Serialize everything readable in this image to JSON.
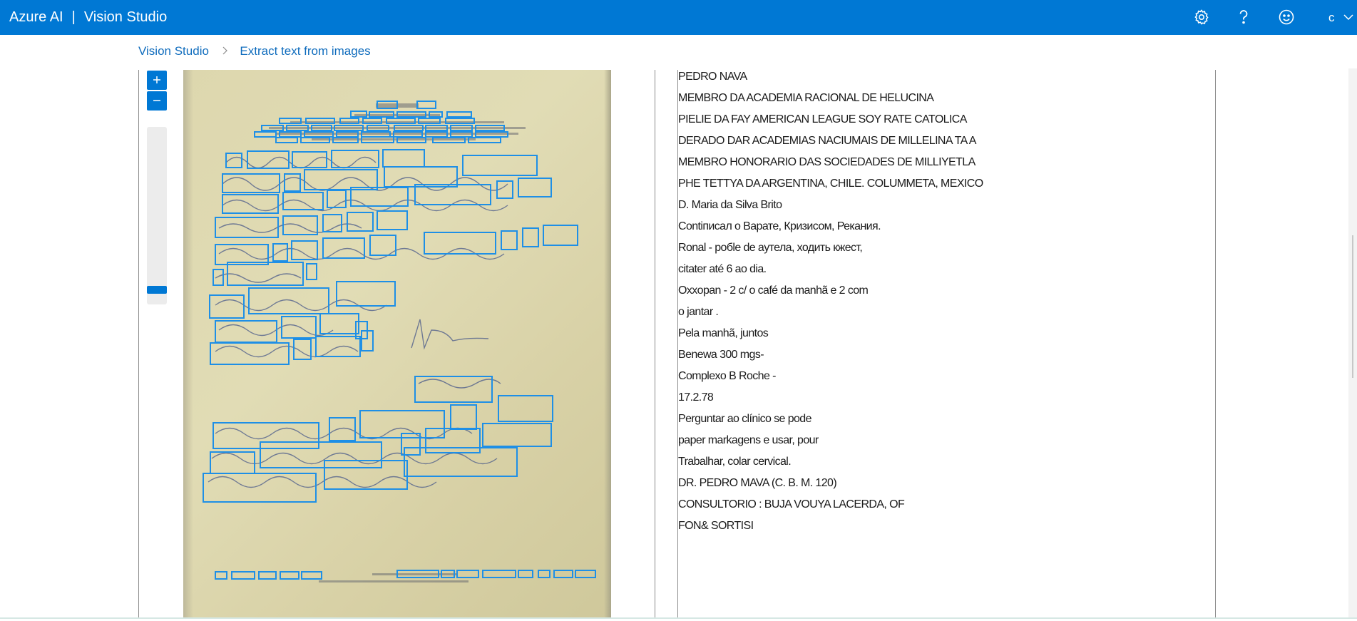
{
  "header": {
    "brand": "Azure AI",
    "separator": "|",
    "product": "Vision Studio",
    "user_initial": "c",
    "icons": [
      "gear-icon",
      "help-icon",
      "smile-icon",
      "chevron-down-icon"
    ]
  },
  "breadcrumb": {
    "items": [
      "Vision Studio",
      "Extract text from images"
    ]
  },
  "viewer": {
    "zoom_in_icon": "plus-icon",
    "zoom_out_icon": "minus-icon",
    "zoom_level": 0.1
  },
  "extracted_text": {
    "lines": [
      "PEDRO NAVA",
      "MEMBRO DA ACADEMIA RACIONAL DE HELUCINA",
      "PIELIE DA FAY AMERICAN LEAGUE SOY RATE CATOLICA",
      "DERADO DAR ACADEMIAS NACIUMAIS DE MILLELINA TA A",
      "MEMBRO HONORARIO DAS SOCIEDADES DE MILLIYETLA",
      "PHE TETTYA DA ARGENTINA, CHILE. COLUMMETA, MEXICO",
      "D. Maria da Silva Brito",
      "Contіписал о Варате, Кризисом, Рекания.",
      "Ronal - робle de aутела, ходить кжест,",
      "citater até 6 ao dia.",
      "Oxxopan - 2 c/ o café da manhã e 2 com",
      "o jantar .",
      "Pela manhã, juntos",
      "Benewa 300 mgs-",
      "Complexo B Roche -",
      "17.2.78",
      "Perguntar ao clínico se pode",
      "paper markagens e usar, pour",
      "Trabalhar, colar cervical.",
      "DR. PEDRO MAVA (C. B. M. 120)",
      "CONSULTORIO : BUJA VOUYA LACERDA, OF",
      "FON& SORTISI"
    ]
  },
  "colors": {
    "accent": "#0078d4",
    "link": "#0f6cbd",
    "ocr_box": "#1e8fe6",
    "paper": "#ddd7ae"
  }
}
